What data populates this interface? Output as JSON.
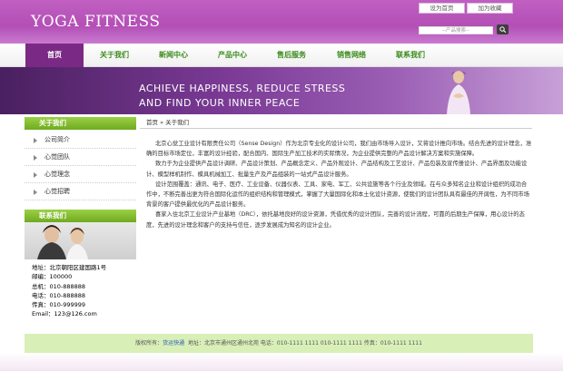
{
  "header": {
    "logo": "YOGA FITNESS",
    "set_home": "设为首页",
    "add_fav": "加为收藏",
    "search_placeholder": "--产品搜索--"
  },
  "nav": [
    "首页",
    "关于我们",
    "新闻中心",
    "产品中心",
    "售后服务",
    "销售网络",
    "联系我们"
  ],
  "banner": {
    "line1": "ACHIEVE HAPPINESS, REDUCE STRESS",
    "line2": "AND FIND YOUR INNER PEACE"
  },
  "sidebar": {
    "about_title": "关于我们",
    "items": [
      "公司简介",
      "心觉团队",
      "心觉理念",
      "心觉招聘"
    ],
    "contact_title": "联系我们",
    "contact": [
      "地址：北京朝阳区建国路1号",
      "邮编：100000",
      "总机：010-888888",
      "电话：010-888888",
      "传真：010-999999",
      "Email：123@126.com"
    ]
  },
  "breadcrumb": "首页 » 关于我们",
  "article": [
    "北京心觉工业设计有限责任公司（Sense Design）作为北京专业化的设计公司，我们由市场导入设计，又将设计推向市场。结合先进的设计理念，准确的目标市场定位，丰富的设计经验，配合国内、国际生产加工技术的实际情况，为企业提供完整的产品设计解决方案和实施保障。",
    "致力于为企业提供产品设计调研、产品设计策划、产品概念定义、产品外观设计、产品结构及工艺设计、产品包装及宣传册设计、产品界面及功能设计、模型样机制作、模具机械加工、批量生产及产品组装的一站式产品设计服务。",
    "设计范围覆盖：通讯、电子、医疗、工业设备、仪器仪表、工具、家电、军工、公共设施等各个行业及领域。在与众多知名企业和设计组织的成功合作中，不断完善出更为符合国际化运作的组织结构和管理模式，掌握了大量国际化和本土化设计资源，使我们的设计团队具有最佳的开阔性，为不同市场背景的客户提供最优化的产品设计服务。",
    "喜家入住北京工业设计产业基地（DRC），依托基地良好的设计资源，凭借优秀的设计团队，完善的设计流程，可靠的后期生产保障，用心设计的态度，先进的设计理念和客户的支持与信任，逐步发展成为知名的设计企业。"
  ],
  "footer": {
    "copyright": "版权所有：",
    "link": "货运快通",
    "address": "地址：北京市通州区通州北苑  电话：010-1111 1111   010-1111 1111   传真：010-1111 1111"
  }
}
